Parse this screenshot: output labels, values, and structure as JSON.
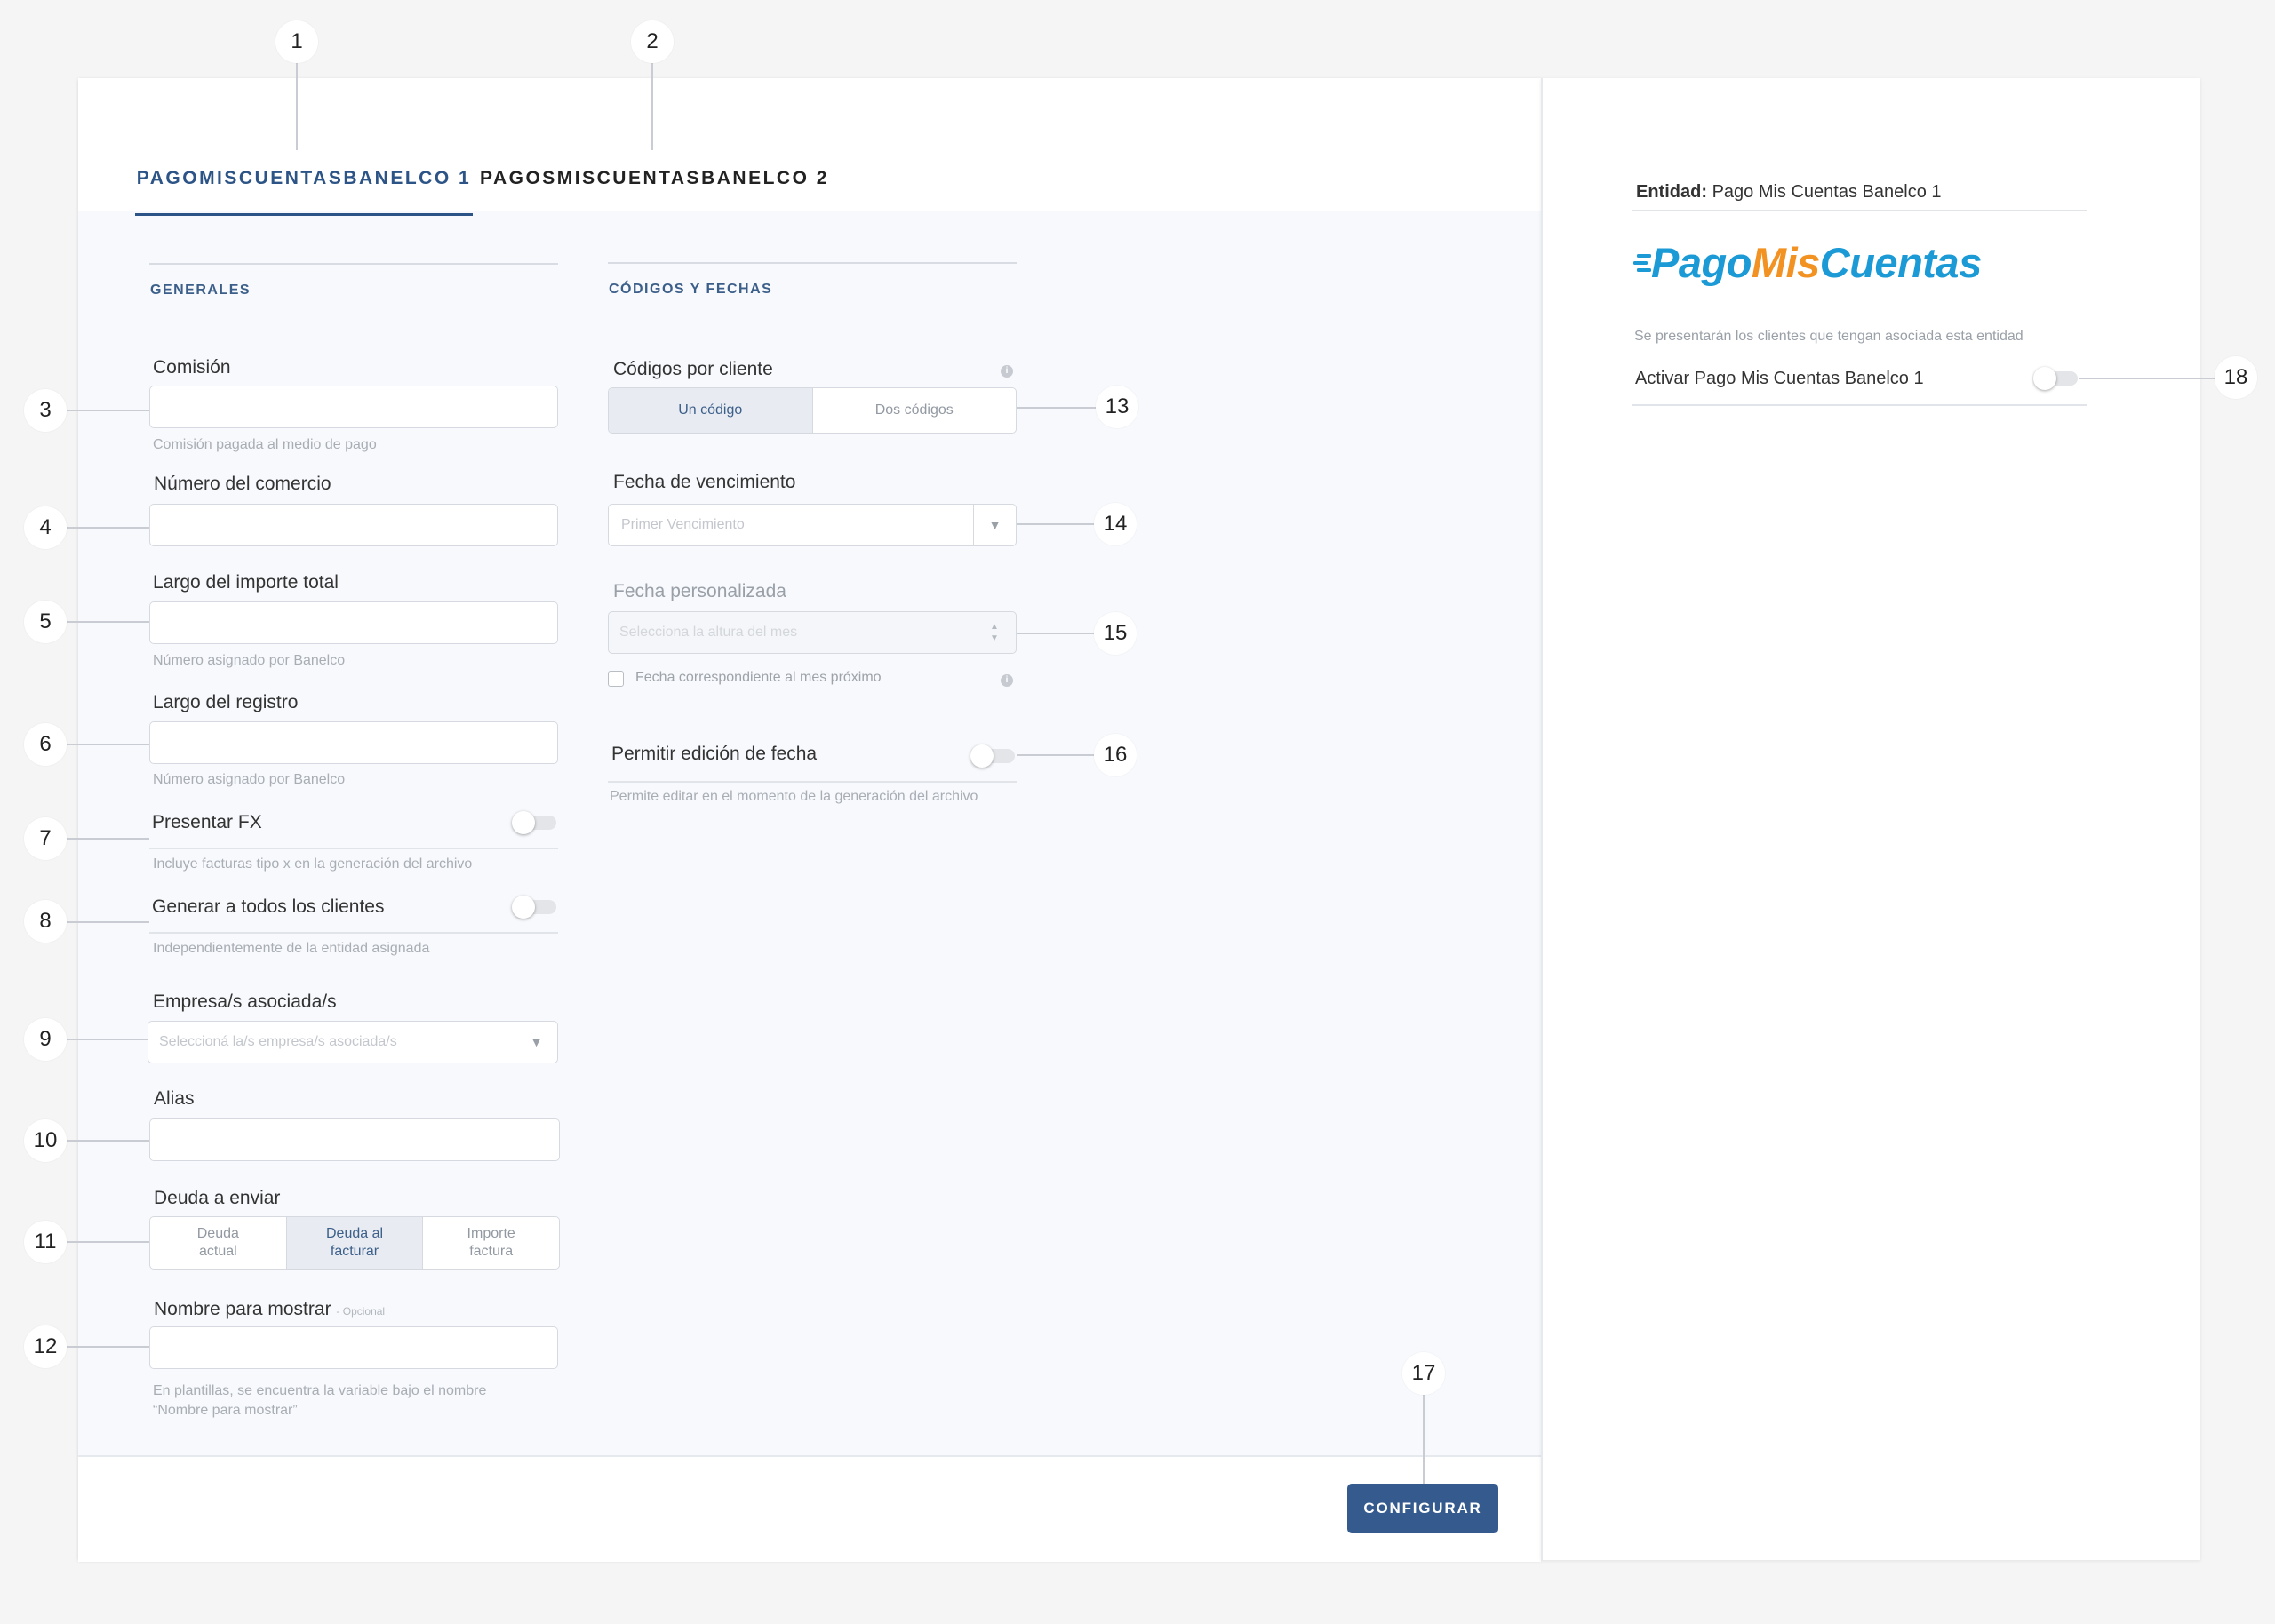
{
  "tabs": [
    {
      "label": "PAGOMISCUENTASBANELCO 1"
    },
    {
      "label": "PAGOSMISCUENTASBANELCO 2"
    }
  ],
  "generales": {
    "title": "GENERALES",
    "comision": {
      "label": "Comisión",
      "value": "",
      "help": "Comisión pagada al medio de pago"
    },
    "numero_comercio": {
      "label": "Número del comercio",
      "value": ""
    },
    "largo_importe": {
      "label": "Largo del importe total",
      "value": "",
      "help": "Número asignado por Banelco"
    },
    "largo_registro": {
      "label": "Largo del registro",
      "value": "",
      "help": "Número asignado por Banelco"
    },
    "presentar_fx": {
      "label": "Presentar FX",
      "on": false,
      "help": "Incluye facturas tipo x en la generación del archivo"
    },
    "generar_todos": {
      "label": "Generar a todos los clientes",
      "on": false,
      "help": "Independientemente de la entidad asignada"
    },
    "empresas": {
      "label": "Empresa/s asociada/s",
      "placeholder": "Seleccioná la/s empresa/s asociada/s"
    },
    "alias": {
      "label": "Alias",
      "value": ""
    },
    "deuda": {
      "label": "Deuda a enviar",
      "options": [
        {
          "line1": "Deuda",
          "line2": "actual"
        },
        {
          "line1": "Deuda al",
          "line2": "facturar"
        },
        {
          "line1": "Importe",
          "line2": "factura"
        }
      ],
      "selected": "Deuda al facturar"
    },
    "nombre_mostrar": {
      "label": "Nombre para mostrar",
      "optional": "- Opcional",
      "value": "",
      "help_line1": "En plantillas, se encuentra la variable bajo el nombre",
      "help_line2": "“Nombre para mostrar”"
    }
  },
  "codigos": {
    "title": "CÓDIGOS Y FECHAS",
    "codigos_cliente": {
      "label": "Códigos por cliente",
      "options": [
        "Un código",
        "Dos códigos"
      ],
      "selected": "Un código"
    },
    "fecha_vencimiento": {
      "label": "Fecha de vencimiento",
      "placeholder": "Primer Vencimiento"
    },
    "fecha_personalizada": {
      "label": "Fecha personalizada",
      "placeholder": "Selecciona la altura del mes"
    },
    "mes_proximo": {
      "label": "Fecha correspondiente al mes próximo",
      "checked": false
    },
    "permitir_edicion": {
      "label": "Permitir edición de fecha",
      "on": false,
      "help": "Permite editar en el momento de la generación del archivo"
    }
  },
  "footer": {
    "configure_label": "CONFIGURAR"
  },
  "side": {
    "entidad_label": "Entidad:",
    "entidad_value": "Pago Mis Cuentas Banelco 1",
    "logo": {
      "part1": "Pago",
      "part2": "Mis",
      "part3": "Cuentas"
    },
    "logo_colors": {
      "blue": "#1b9ad6",
      "orange": "#f29222"
    },
    "desc": "Se presentarán los clientes que tengan asociada esta entidad",
    "activar_label": "Activar Pago Mis Cuentas Banelco 1",
    "activar_on": false
  },
  "callouts": [
    "1",
    "2",
    "3",
    "4",
    "5",
    "6",
    "7",
    "8",
    "9",
    "10",
    "11",
    "12",
    "13",
    "14",
    "15",
    "16",
    "17",
    "18"
  ],
  "colors": {
    "accent": "#345a8e",
    "tab_active": "#2c5486",
    "background": "#f5f5f6"
  }
}
